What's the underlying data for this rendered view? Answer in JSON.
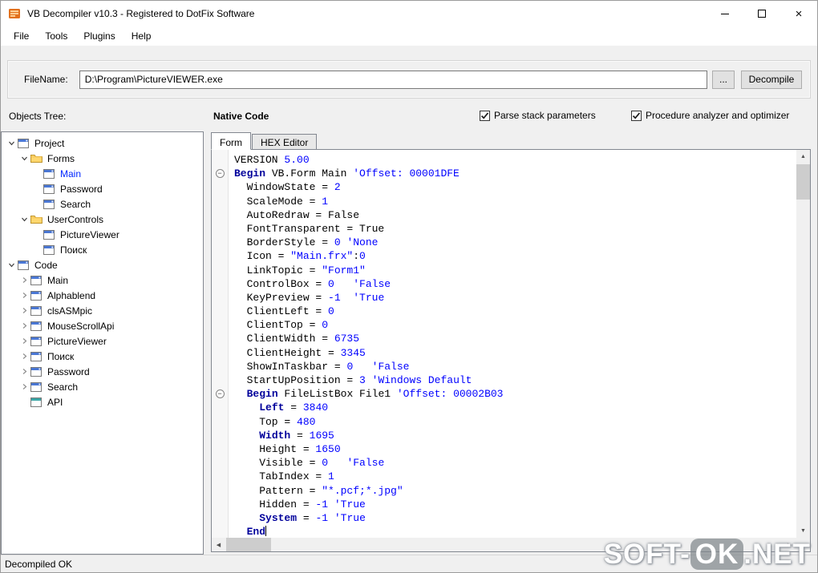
{
  "window": {
    "title": "VB Decompiler v10.3 - Registered to DotFix Software"
  },
  "menu": {
    "items": [
      "File",
      "Tools",
      "Plugins",
      "Help"
    ]
  },
  "toolbar": {
    "filename_label": "FileName:",
    "filename_value": "D:\\Program\\PictureVIEWER.exe",
    "browse_label": "...",
    "decompile_label": "Decompile"
  },
  "options": {
    "objects_tree_label": "Objects Tree:",
    "native_code_label": "Native Code",
    "checkboxes": [
      {
        "label": "Parse stack parameters",
        "checked": true
      },
      {
        "label": "Procedure analyzer and optimizer",
        "checked": true
      }
    ]
  },
  "tree": {
    "items": [
      {
        "level": 0,
        "label": "Project",
        "icon": "project",
        "expander": "down"
      },
      {
        "level": 1,
        "label": "Forms",
        "icon": "folder",
        "expander": "down"
      },
      {
        "level": 2,
        "label": "Main",
        "icon": "form",
        "expander": "none",
        "selected": true
      },
      {
        "level": 2,
        "label": "Password",
        "icon": "form",
        "expander": "none"
      },
      {
        "level": 2,
        "label": "Search",
        "icon": "form",
        "expander": "none"
      },
      {
        "level": 1,
        "label": "UserControls",
        "icon": "folder",
        "expander": "down"
      },
      {
        "level": 2,
        "label": "PictureViewer",
        "icon": "form",
        "expander": "none"
      },
      {
        "level": 2,
        "label": "Поиск",
        "icon": "form",
        "expander": "none"
      },
      {
        "level": 0,
        "label": "Code",
        "icon": "project",
        "expander": "down"
      },
      {
        "level": 1,
        "label": "Main",
        "icon": "module",
        "expander": "right"
      },
      {
        "level": 1,
        "label": "Alphablend",
        "icon": "module",
        "expander": "right"
      },
      {
        "level": 1,
        "label": "clsASMpic",
        "icon": "module",
        "expander": "right"
      },
      {
        "level": 1,
        "label": "MouseScrollApi",
        "icon": "module",
        "expander": "right"
      },
      {
        "level": 1,
        "label": "PictureViewer",
        "icon": "module",
        "expander": "right"
      },
      {
        "level": 1,
        "label": "Поиск",
        "icon": "module",
        "expander": "right"
      },
      {
        "level": 1,
        "label": "Password",
        "icon": "module",
        "expander": "right"
      },
      {
        "level": 1,
        "label": "Search",
        "icon": "module",
        "expander": "right"
      },
      {
        "level": 1,
        "label": "API",
        "icon": "api",
        "expander": "none"
      }
    ]
  },
  "editor": {
    "tabs": [
      {
        "label": "Form",
        "active": true
      },
      {
        "label": "HEX Editor",
        "active": false
      }
    ],
    "lines": [
      {
        "tokens": [
          {
            "t": "VERSION ",
            "c": "p"
          },
          {
            "t": "5.00",
            "c": "b"
          }
        ]
      },
      {
        "fold": true,
        "tokens": [
          {
            "t": "Begin",
            "c": "k"
          },
          {
            "t": " VB.Form Main ",
            "c": "p"
          },
          {
            "t": "'Offset: 00001DFE",
            "c": "b"
          }
        ]
      },
      {
        "tokens": [
          {
            "t": "  WindowState = ",
            "c": "p"
          },
          {
            "t": "2",
            "c": "b"
          }
        ]
      },
      {
        "tokens": [
          {
            "t": "  ScaleMode = ",
            "c": "p"
          },
          {
            "t": "1",
            "c": "b"
          }
        ]
      },
      {
        "tokens": [
          {
            "t": "  AutoRedraw = False",
            "c": "p"
          }
        ]
      },
      {
        "tokens": [
          {
            "t": "  FontTransparent = True",
            "c": "p"
          }
        ]
      },
      {
        "tokens": [
          {
            "t": "  BorderStyle = ",
            "c": "p"
          },
          {
            "t": "0",
            "c": "b"
          },
          {
            "t": " ",
            "c": "p"
          },
          {
            "t": "'None",
            "c": "b"
          }
        ]
      },
      {
        "tokens": [
          {
            "t": "  Icon = ",
            "c": "p"
          },
          {
            "t": "\"Main.frx\"",
            "c": "b"
          },
          {
            "t": ":",
            "c": "p"
          },
          {
            "t": "0",
            "c": "b"
          }
        ]
      },
      {
        "tokens": [
          {
            "t": "  LinkTopic = ",
            "c": "p"
          },
          {
            "t": "\"Form1\"",
            "c": "b"
          }
        ]
      },
      {
        "tokens": [
          {
            "t": "  ControlBox = ",
            "c": "p"
          },
          {
            "t": "0",
            "c": "b"
          },
          {
            "t": "   ",
            "c": "p"
          },
          {
            "t": "'False",
            "c": "b"
          }
        ]
      },
      {
        "tokens": [
          {
            "t": "  KeyPreview = ",
            "c": "p"
          },
          {
            "t": "-1",
            "c": "b"
          },
          {
            "t": "  ",
            "c": "p"
          },
          {
            "t": "'True",
            "c": "b"
          }
        ]
      },
      {
        "tokens": [
          {
            "t": "  ClientLeft = ",
            "c": "p"
          },
          {
            "t": "0",
            "c": "b"
          }
        ]
      },
      {
        "tokens": [
          {
            "t": "  ClientTop = ",
            "c": "p"
          },
          {
            "t": "0",
            "c": "b"
          }
        ]
      },
      {
        "tokens": [
          {
            "t": "  ClientWidth = ",
            "c": "p"
          },
          {
            "t": "6735",
            "c": "b"
          }
        ]
      },
      {
        "tokens": [
          {
            "t": "  ClientHeight = ",
            "c": "p"
          },
          {
            "t": "3345",
            "c": "b"
          }
        ]
      },
      {
        "tokens": [
          {
            "t": "  ShowInTaskbar = ",
            "c": "p"
          },
          {
            "t": "0",
            "c": "b"
          },
          {
            "t": "   ",
            "c": "p"
          },
          {
            "t": "'False",
            "c": "b"
          }
        ]
      },
      {
        "tokens": [
          {
            "t": "  StartUpPosition = ",
            "c": "p"
          },
          {
            "t": "3",
            "c": "b"
          },
          {
            "t": " ",
            "c": "p"
          },
          {
            "t": "'Windows Default",
            "c": "b"
          }
        ]
      },
      {
        "fold": true,
        "tokens": [
          {
            "t": "  ",
            "c": "p"
          },
          {
            "t": "Begin",
            "c": "k"
          },
          {
            "t": " FileListBox File1 ",
            "c": "p"
          },
          {
            "t": "'Offset: 00002B03",
            "c": "b"
          }
        ]
      },
      {
        "tokens": [
          {
            "t": "    ",
            "c": "p"
          },
          {
            "t": "Left",
            "c": "k"
          },
          {
            "t": " = ",
            "c": "p"
          },
          {
            "t": "3840",
            "c": "b"
          }
        ]
      },
      {
        "tokens": [
          {
            "t": "    Top = ",
            "c": "p"
          },
          {
            "t": "480",
            "c": "b"
          }
        ]
      },
      {
        "tokens": [
          {
            "t": "    ",
            "c": "p"
          },
          {
            "t": "Width",
            "c": "k"
          },
          {
            "t": " = ",
            "c": "p"
          },
          {
            "t": "1695",
            "c": "b"
          }
        ]
      },
      {
        "tokens": [
          {
            "t": "    Height = ",
            "c": "p"
          },
          {
            "t": "1650",
            "c": "b"
          }
        ]
      },
      {
        "tokens": [
          {
            "t": "    Visible = ",
            "c": "p"
          },
          {
            "t": "0",
            "c": "b"
          },
          {
            "t": "   ",
            "c": "p"
          },
          {
            "t": "'False",
            "c": "b"
          }
        ]
      },
      {
        "tokens": [
          {
            "t": "    TabIndex = ",
            "c": "p"
          },
          {
            "t": "1",
            "c": "b"
          }
        ]
      },
      {
        "tokens": [
          {
            "t": "    Pattern = ",
            "c": "p"
          },
          {
            "t": "\"*.pcf;*.jpg\"",
            "c": "b"
          }
        ]
      },
      {
        "tokens": [
          {
            "t": "    Hidden = ",
            "c": "p"
          },
          {
            "t": "-1",
            "c": "b"
          },
          {
            "t": " ",
            "c": "p"
          },
          {
            "t": "'True",
            "c": "b"
          }
        ]
      },
      {
        "tokens": [
          {
            "t": "    ",
            "c": "p"
          },
          {
            "t": "System",
            "c": "k"
          },
          {
            "t": " = ",
            "c": "p"
          },
          {
            "t": "-1",
            "c": "b"
          },
          {
            "t": " ",
            "c": "p"
          },
          {
            "t": "'True",
            "c": "b"
          }
        ]
      },
      {
        "caret": true,
        "tokens": [
          {
            "t": "  ",
            "c": "p"
          },
          {
            "t": "End",
            "c": "k"
          }
        ]
      }
    ]
  },
  "status": {
    "text": "Decompiled OK"
  },
  "watermark": {
    "prefix": "SOFT-",
    "mid": "OK",
    "suffix": ".NET"
  },
  "colors": {
    "keyword": "#00009B",
    "literal": "#0000FF",
    "selected_item": "#0026FF"
  }
}
